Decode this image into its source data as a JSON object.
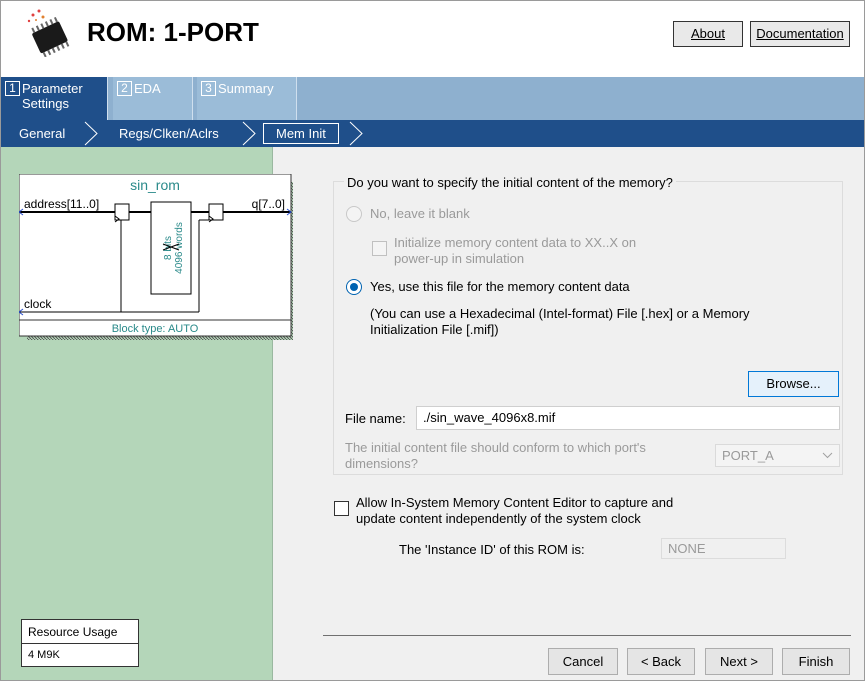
{
  "window": {
    "title": "ROM: 1-PORT",
    "about_label": "About",
    "documentation_label": "Documentation"
  },
  "tabs": [
    {
      "num": "1",
      "label": "Parameter Settings",
      "active": true
    },
    {
      "num": "2",
      "label": "EDA",
      "active": false
    },
    {
      "num": "3",
      "label": "Summary",
      "active": false
    }
  ],
  "subtabs": [
    {
      "label": "General"
    },
    {
      "label": "Regs/Clken/Aclrs"
    },
    {
      "label": "Mem Init",
      "active": true
    }
  ],
  "diagram": {
    "name": "sin_rom",
    "address_port": "address[11..0]",
    "q_port": "q[7..0]",
    "clock_port": "clock",
    "bits": "8 bits",
    "words": "4096 words",
    "block_type": "Block type: AUTO"
  },
  "resource_usage": {
    "header": "Resource Usage",
    "value": "4 M9K"
  },
  "mem_init": {
    "question": "Do you want to specify the initial content of the memory?",
    "option_no": "No, leave it blank",
    "init_xx_line1": "Initialize memory content data to XX..X on",
    "init_xx_line2": "power-up in simulation",
    "option_yes": "Yes, use this file for the memory content data",
    "hint_line1": "(You can use a Hexadecimal (Intel-format) File [.hex] or a Memory",
    "hint_line2": "Initialization File [.mif])",
    "browse_label": "Browse...",
    "file_name_label": "File name:",
    "file_name_value": "./sin_wave_4096x8.mif",
    "port_question_line1": "The initial content file should conform to which port's",
    "port_question_line2": "dimensions?",
    "port_value": "PORT_A",
    "allow_editor_line1": "Allow In-System Memory Content Editor to capture and",
    "allow_editor_line2": "update content independently of the system clock",
    "instance_id_label": "The 'Instance ID' of this ROM is:",
    "instance_id_value": "NONE"
  },
  "footer": {
    "cancel_label": "Cancel",
    "back_label": "< Back",
    "next_label": "Next >",
    "finish_label": "Finish"
  },
  "colors": {
    "tab_active": "#1f4f8a",
    "tab_bar": "#8eb0cf",
    "left_panel": "#b4d6b9",
    "radio_accent": "#0063b1",
    "diagram_text": "#2a8a8a"
  }
}
